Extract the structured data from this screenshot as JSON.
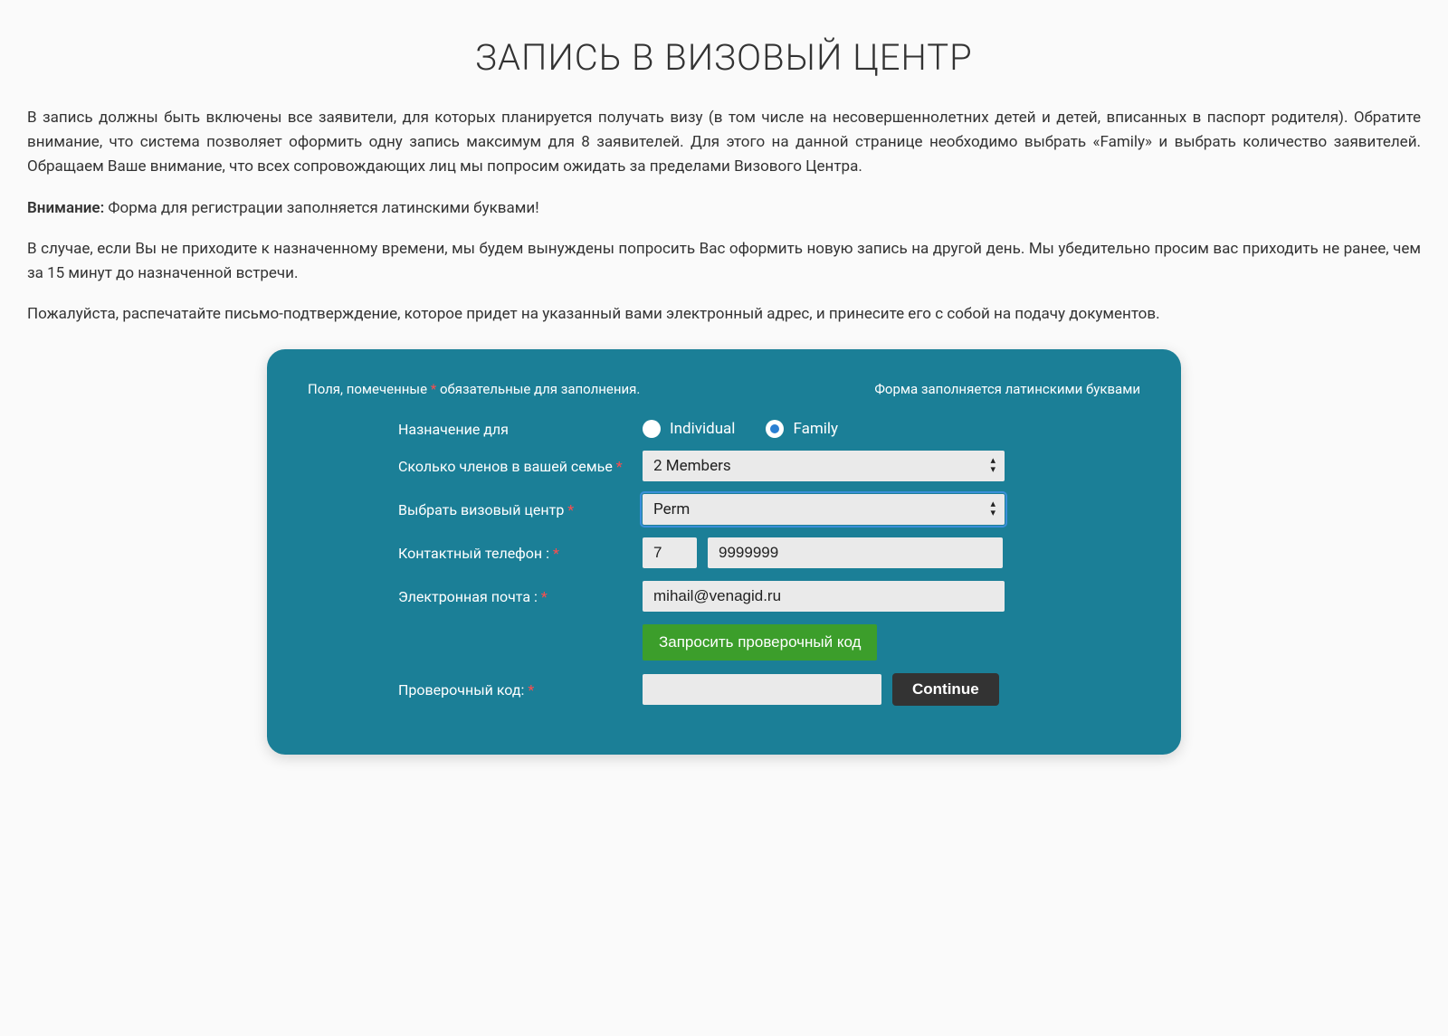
{
  "title": "ЗАПИСЬ В ВИЗОВЫЙ ЦЕНТР",
  "intro": {
    "p1": "В запись должны быть включены все заявители, для которых планируется получать визу (в том числе на несовершеннолетних детей и детей, вписанных в паспорт родителя). Обратите внимание, что система позволяет оформить одну запись максимум для 8 заявителей. Для этого на данной странице необходимо выбрать «Family» и выбрать количество заявителей. Обращаем Ваше внимание, что всех сопровождающих лиц мы попросим ожидать за пределами Визового Центра.",
    "attention_label": "Внимание:",
    "attention_text": " Форма для регистрации заполняется латинскими буквами!",
    "p3": "В случае, если Вы не приходите к назначенному времени, мы будем вынуждены попросить Вас оформить новую запись на другой день. Мы убедительно просим вас приходить не ранее, чем за 15 минут до назначенной встречи.",
    "p4": "Пожалуйста, распечатайте письмо-подтверждение, которое придет на указанный вами электронный адрес, и принесите его с собой на подачу документов."
  },
  "form": {
    "required_note_pre": "Поля, помеченные ",
    "required_note_post": " обязательные для заполнения.",
    "latin_note": "Форма заполняется латинскими буквами",
    "labels": {
      "appointment_for": "Назначение для",
      "members_count": "Сколько членов в вашей семье ",
      "visa_center": "Выбрать визовый центр ",
      "phone": "Контактный телефон : ",
      "email": "Электронная почта : ",
      "verify_code": "Проверочный код: "
    },
    "radio": {
      "individual": "Individual",
      "family": "Family",
      "selected": "family"
    },
    "members_value": "2 Members",
    "center_value": "Perm",
    "phone_cc": "7",
    "phone_number": "9999999",
    "email_value": "mihail@venagid.ru",
    "request_code_btn": "Запросить проверочный код",
    "verify_code_value": "",
    "continue_btn": "Continue",
    "asterisk": "*"
  }
}
